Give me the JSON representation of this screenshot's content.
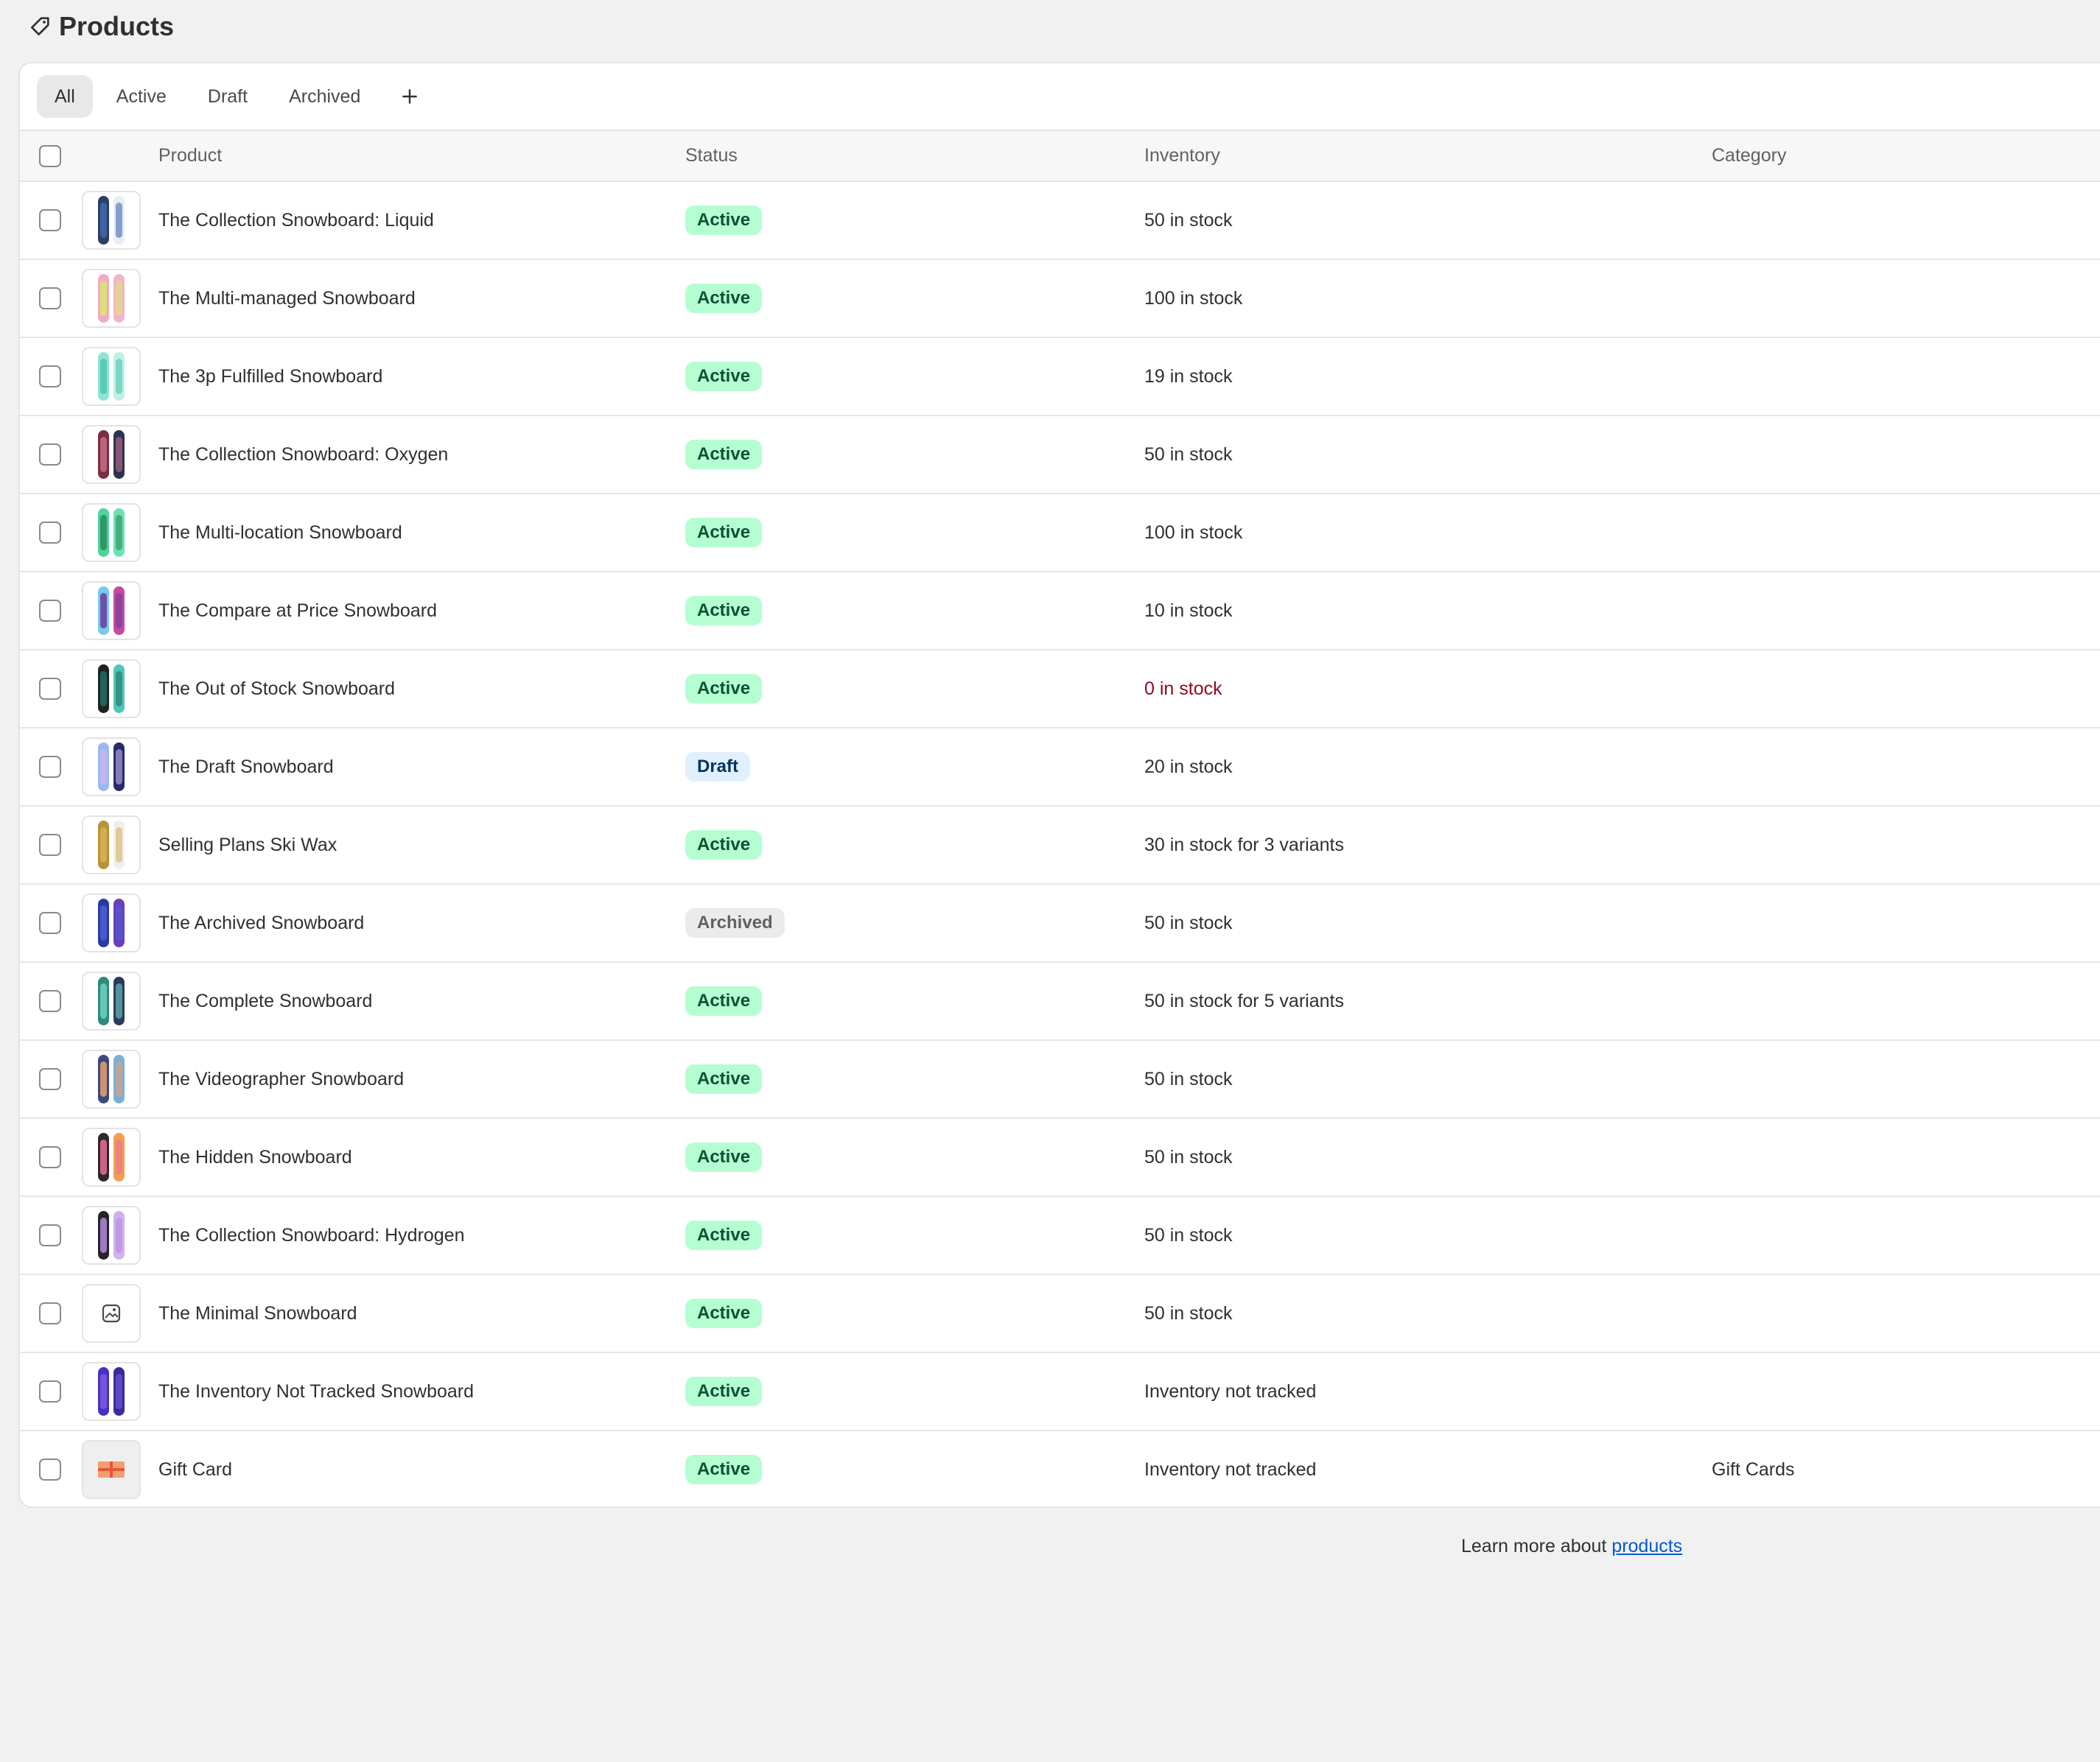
{
  "page": {
    "title": "Products",
    "icon": "tag-icon"
  },
  "tabs": [
    {
      "label": "All",
      "selected": true
    },
    {
      "label": "Active",
      "selected": false
    },
    {
      "label": "Draft",
      "selected": false
    },
    {
      "label": "Archived",
      "selected": false
    }
  ],
  "add_tab_icon": "plus-icon",
  "columns": {
    "product": "Product",
    "status": "Status",
    "inventory": "Inventory",
    "category": "Category"
  },
  "products": [
    {
      "name": "The Collection Snowboard: Liquid",
      "status": "Active",
      "inventory": "50 in stock",
      "category": "",
      "thumb": [
        "#2c3e66",
        "#3f6bb0",
        "#e9edf5"
      ]
    },
    {
      "name": "The Multi-managed Snowboard",
      "status": "Active",
      "inventory": "100 in stock",
      "category": "",
      "thumb": [
        "#f2a9c4",
        "#d8e86a",
        "#f4b3cc"
      ]
    },
    {
      "name": "The 3p Fulfilled Snowboard",
      "status": "Active",
      "inventory": "19 in stock",
      "category": "",
      "thumb": [
        "#8fe3d0",
        "#4fc7b0",
        "#bff1e4"
      ]
    },
    {
      "name": "The Collection Snowboard: Oxygen",
      "status": "Active",
      "inventory": "50 in stock",
      "category": "",
      "thumb": [
        "#7a2e3e",
        "#c86a8a",
        "#2a3350"
      ]
    },
    {
      "name": "The Multi-location Snowboard",
      "status": "Active",
      "inventory": "100 in stock",
      "category": "",
      "thumb": [
        "#4fd39a",
        "#2a8a5e",
        "#6fe0b0"
      ]
    },
    {
      "name": "The Compare at Price Snowboard",
      "status": "Active",
      "inventory": "10 in stock",
      "category": "",
      "thumb": [
        "#7ac9ef",
        "#6a3b9e",
        "#c64b9e"
      ]
    },
    {
      "name": "The Out of Stock Snowboard",
      "status": "Active",
      "inventory": "0 in stock",
      "category": "",
      "thumb": [
        "#222222",
        "#1f6f6a",
        "#4fc7b6"
      ]
    },
    {
      "name": "The Draft Snowboard",
      "status": "Draft",
      "inventory": "20 in stock",
      "category": "",
      "thumb": [
        "#9ab8f2",
        "#c7b4f0",
        "#2a2a6a"
      ]
    },
    {
      "name": "Selling Plans Ski Wax",
      "status": "Active",
      "inventory": "30 in stock for 3 variants",
      "category": "",
      "thumb": [
        "#b8923a",
        "#d9b155",
        "#efefef"
      ]
    },
    {
      "name": "The Archived Snowboard",
      "status": "Archived",
      "inventory": "50 in stock",
      "category": "",
      "thumb": [
        "#2b3a9e",
        "#4b5fd6",
        "#6a3fb8"
      ]
    },
    {
      "name": "The Complete Snowboard",
      "status": "Active",
      "inventory": "50 in stock for 5 variants",
      "category": "",
      "thumb": [
        "#2f8a7a",
        "#6fd1bf",
        "#2a3a5e"
      ]
    },
    {
      "name": "The Videographer Snowboard",
      "status": "Active",
      "inventory": "50 in stock",
      "category": "",
      "thumb": [
        "#3a4a7a",
        "#e8a070",
        "#7ab0d6"
      ]
    },
    {
      "name": "The Hidden Snowboard",
      "status": "Active",
      "inventory": "50 in stock",
      "category": "",
      "thumb": [
        "#2a2a2a",
        "#ef6a9a",
        "#f0a050"
      ]
    },
    {
      "name": "The Collection Snowboard: Hydrogen",
      "status": "Active",
      "inventory": "50 in stock",
      "category": "",
      "thumb": [
        "#262626",
        "#b48ae0",
        "#d0b0f0"
      ]
    },
    {
      "name": "The Minimal Snowboard",
      "status": "Active",
      "inventory": "50 in stock",
      "category": "",
      "thumb": "placeholder"
    },
    {
      "name": "The Inventory Not Tracked Snowboard",
      "status": "Active",
      "inventory": "Inventory not tracked",
      "category": "",
      "thumb": [
        "#4a2fc0",
        "#7a5ae0",
        "#3a2a9e"
      ]
    },
    {
      "name": "Gift Card",
      "status": "Active",
      "inventory": "Inventory not tracked",
      "category": "Gift Cards",
      "thumb": "gift"
    }
  ],
  "footer": {
    "text": "Learn more about ",
    "link": "products"
  }
}
